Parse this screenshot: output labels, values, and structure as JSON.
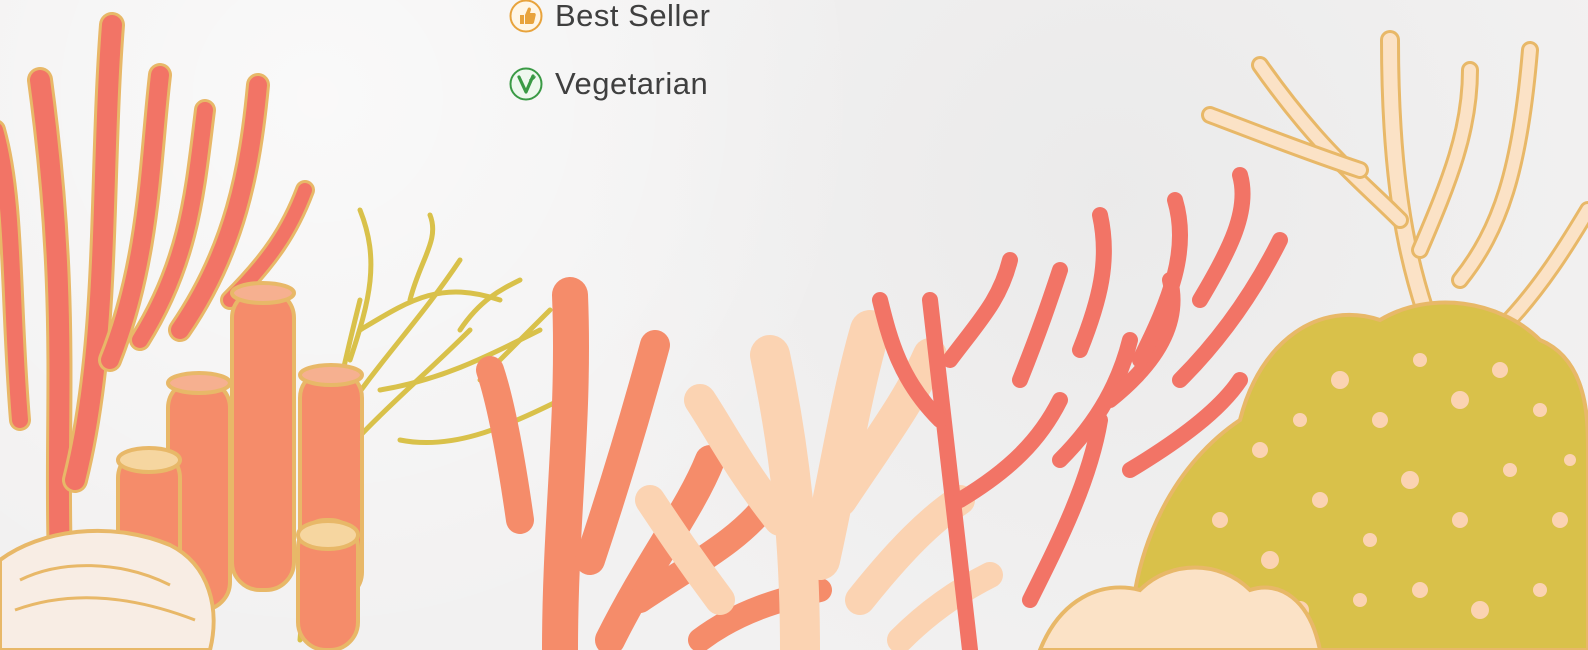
{
  "legend": {
    "items": [
      {
        "icon": "thumbs-up-icon",
        "label": "Best Seller",
        "color": "#e8a33c"
      },
      {
        "icon": "vegetarian-v-icon",
        "label": "Vegetarian",
        "color": "#3a9a45"
      }
    ]
  },
  "illustration": {
    "subject": "coral-reef",
    "colors": {
      "coral_red": "#f27466",
      "coral_salmon": "#f5a07e",
      "coral_peach": "#fbd3b2",
      "coral_yellow": "#d9c14a",
      "coral_outline": "#e8b868",
      "paper": "#f2f1f1"
    }
  }
}
